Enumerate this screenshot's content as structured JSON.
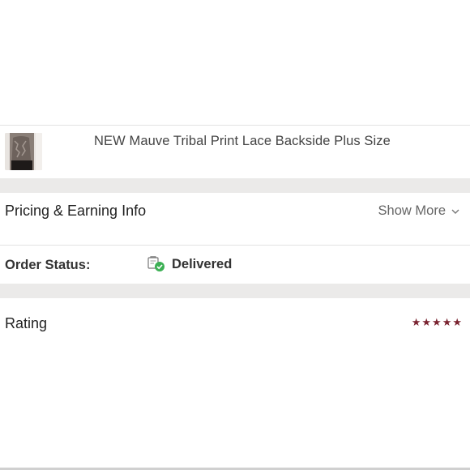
{
  "item": {
    "title": "NEW Mauve Tribal Print Lace Backside Plus Size",
    "thumbnail": "product-photo"
  },
  "pricing": {
    "label": "Pricing & Earning Info",
    "show_more": "Show More",
    "chevron_icon": "chevron-down-icon"
  },
  "order_status": {
    "label": "Order Status:",
    "value": "Delivered",
    "icon": "delivered-check-icon",
    "check_color": "#3cb054"
  },
  "rating": {
    "label": "Rating",
    "stars": 5,
    "max_stars": 5,
    "star_color": "#7a2330"
  },
  "colors": {
    "separator": "#ebeae9",
    "text": "#333333"
  }
}
